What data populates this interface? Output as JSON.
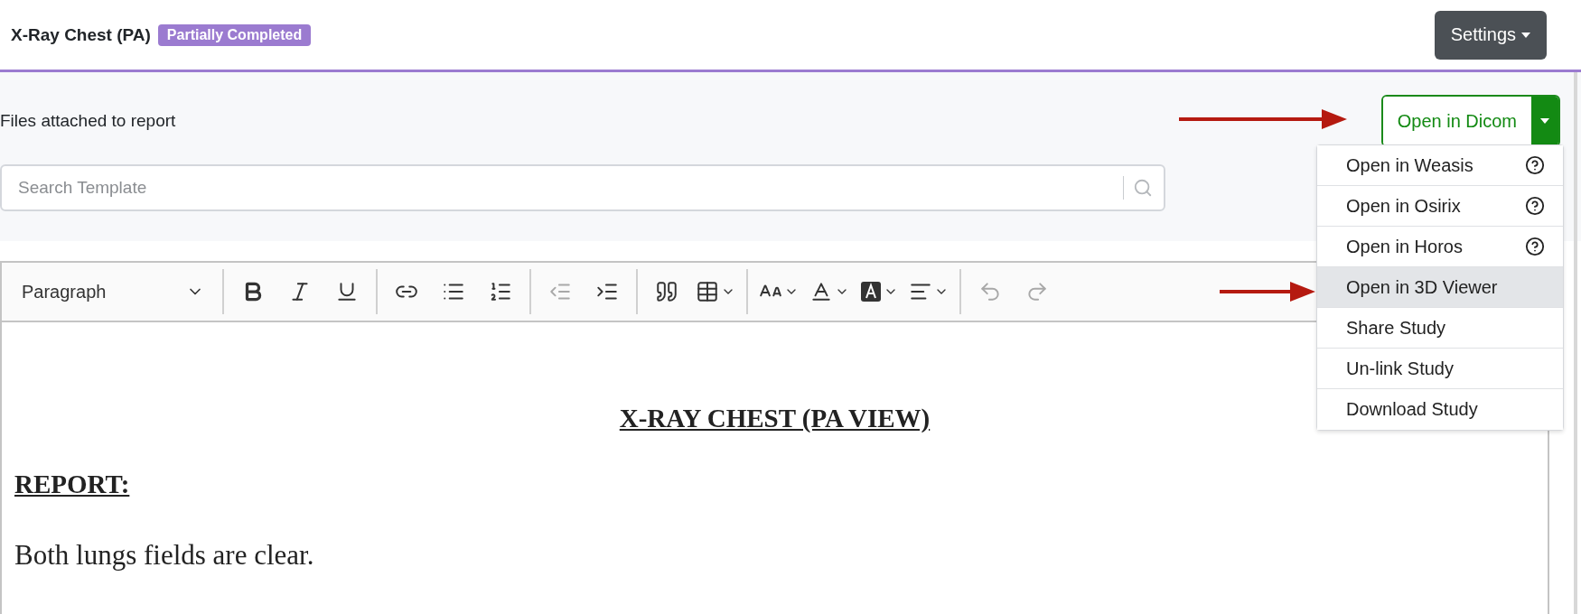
{
  "header": {
    "title": "X-Ray Chest (PA)",
    "badge": "Partially Completed",
    "settings_button": "Settings"
  },
  "files_label": "Files attached to report",
  "dicom_button": {
    "label": "Open in Dicom",
    "expanded": true
  },
  "dicom_menu": [
    {
      "label": "Open in Weasis",
      "kind": "help",
      "selected": false
    },
    {
      "label": "Open in Osirix",
      "kind": "help",
      "selected": false
    },
    {
      "label": "Open in Horos",
      "kind": "help",
      "selected": false
    },
    {
      "label": "Open in 3D Viewer",
      "kind": "plain",
      "selected": true
    },
    {
      "label": "Share Study",
      "kind": "plain",
      "selected": false
    },
    {
      "label": "Un-link Study",
      "kind": "plain",
      "selected": false
    },
    {
      "label": "Download Study",
      "kind": "plain",
      "selected": false
    }
  ],
  "search": {
    "placeholder": "Search Template"
  },
  "editor": {
    "heading_select": "Paragraph",
    "toolbar_groups": [
      [
        {
          "kind": "bold",
          "disabled": false
        },
        {
          "kind": "italic",
          "disabled": false
        },
        {
          "kind": "underline",
          "disabled": false
        }
      ],
      [
        {
          "kind": "link",
          "disabled": false
        },
        {
          "kind": "bullets",
          "disabled": false
        },
        {
          "kind": "numbers",
          "disabled": false
        }
      ],
      [
        {
          "kind": "outdent",
          "disabled": true
        },
        {
          "kind": "indent",
          "disabled": false
        }
      ],
      [
        {
          "kind": "quote",
          "disabled": false
        },
        {
          "kind": "table",
          "disabled": false
        }
      ],
      [
        {
          "kind": "fontsize",
          "disabled": false
        },
        {
          "kind": "fontcolor",
          "disabled": false
        },
        {
          "kind": "highlight",
          "disabled": false
        },
        {
          "kind": "align",
          "disabled": false
        }
      ],
      [
        {
          "kind": "undo",
          "disabled": true
        },
        {
          "kind": "redo",
          "disabled": true
        }
      ]
    ],
    "content": [
      {
        "kind": "title",
        "text": "X-RAY CHEST (PA VIEW)"
      },
      {
        "kind": "section",
        "text": "REPORT:"
      },
      {
        "kind": "para",
        "text": "Both lungs fields are clear."
      }
    ]
  }
}
